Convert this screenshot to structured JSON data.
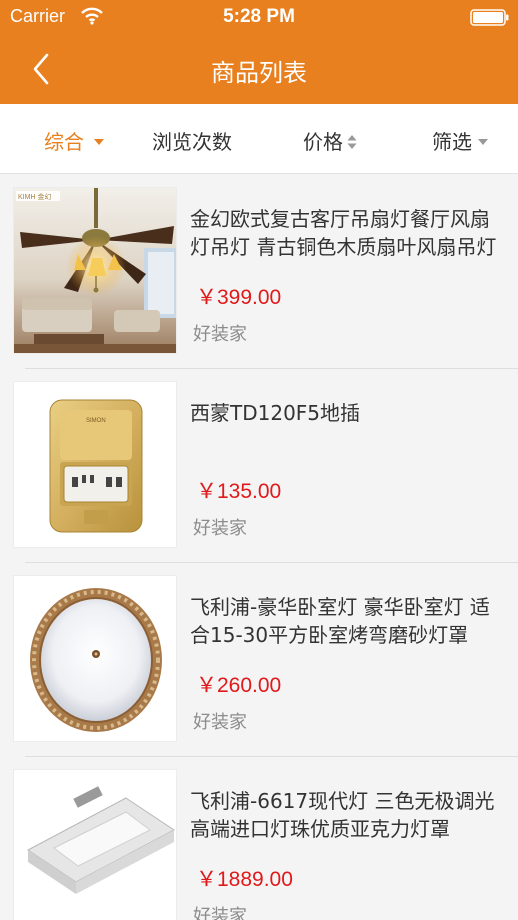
{
  "status_bar": {
    "carrier": "Carrier",
    "time": "5:28 PM"
  },
  "nav": {
    "title": "商品列表"
  },
  "filters": [
    {
      "label": "综合",
      "active": true
    },
    {
      "label": "浏览次数"
    },
    {
      "label": "价格"
    },
    {
      "label": "筛选"
    }
  ],
  "products": [
    {
      "title": "金幻欧式复古客厅吊扇灯餐厅风扇灯吊灯 青古铜色木质扇叶风扇吊灯",
      "price": "￥399.00",
      "shop": "好装家",
      "image": "ceiling-fan-lamp",
      "brand_mark": "KIMH 金幻"
    },
    {
      "title": "西蒙TD120F5地插",
      "price": "￥135.00",
      "shop": "好装家",
      "image": "floor-socket",
      "brand_mark": "SIMON"
    },
    {
      "title": "飞利浦-豪华卧室灯 豪华卧室灯 适合15-30平方卧室烤弯磨砂灯罩",
      "price": "￥260.00",
      "shop": "好装家",
      "image": "round-ceiling-light"
    },
    {
      "title": "飞利浦-6617现代灯 三色无极调光高端进口灯珠优质亚克力灯罩",
      "price": "￥1889.00",
      "shop": "好装家",
      "image": "square-panel-light"
    }
  ]
}
